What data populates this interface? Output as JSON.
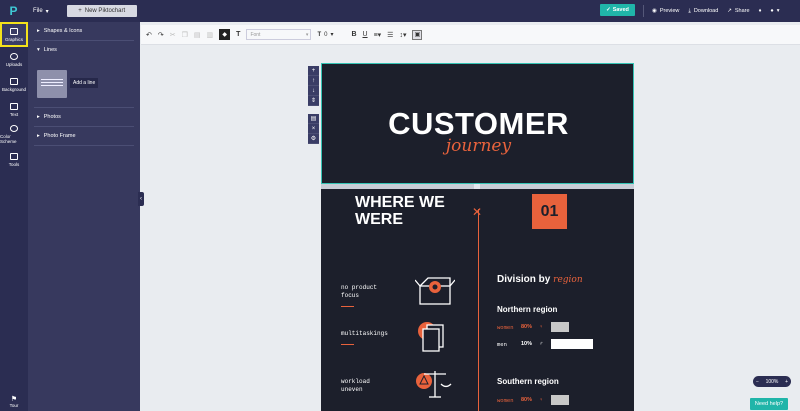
{
  "topbar": {
    "file_label": "File",
    "new_label": "New Piktochart",
    "saved_label": "Saved",
    "preview_label": "Preview",
    "download_label": "Download",
    "share_label": "Share"
  },
  "rail": {
    "items": [
      {
        "label": "Graphics"
      },
      {
        "label": "Uploads"
      },
      {
        "label": "Background"
      },
      {
        "label": "Text"
      },
      {
        "label": "Color Scheme"
      },
      {
        "label": "Tools"
      }
    ],
    "tour_label": "Tour"
  },
  "panel": {
    "sections": [
      {
        "label": "Shapes & Icons"
      },
      {
        "label": "Lines"
      },
      {
        "label": "Photos"
      },
      {
        "label": "Photo Frame"
      }
    ],
    "tooltip": "Add a line"
  },
  "toolbar": {
    "font_placeholder": "Font",
    "font_size": "0",
    "bold": "B",
    "underline": "U",
    "text_icon": "T"
  },
  "canvas": {
    "title": "CUSTOMER",
    "subtitle": "journey",
    "section_heading_1": "WHERE WE",
    "section_heading_2": "WERE",
    "number": "01",
    "items": [
      {
        "line1": "no product",
        "line2": "focus"
      },
      {
        "line1": "multitaskings",
        "line2": ""
      },
      {
        "line1": "workload",
        "line2": "uneven"
      }
    ],
    "division_title": "Division by",
    "division_word": "region",
    "northern": "Northern region",
    "southern": "Southern region",
    "stats": [
      {
        "label": "women",
        "pct": "80%",
        "value": 0.8
      },
      {
        "label": "men",
        "pct": "10%",
        "value": 0.1
      },
      {
        "label": "women",
        "pct": "80%",
        "value": 0.8
      }
    ]
  },
  "zoom_label": "100%",
  "help_label": "Need help?",
  "colors": {
    "accent": "#e8623c",
    "teal": "#20b5a9",
    "dark": "#1c1f2b",
    "highlight": "#f4e21b"
  }
}
